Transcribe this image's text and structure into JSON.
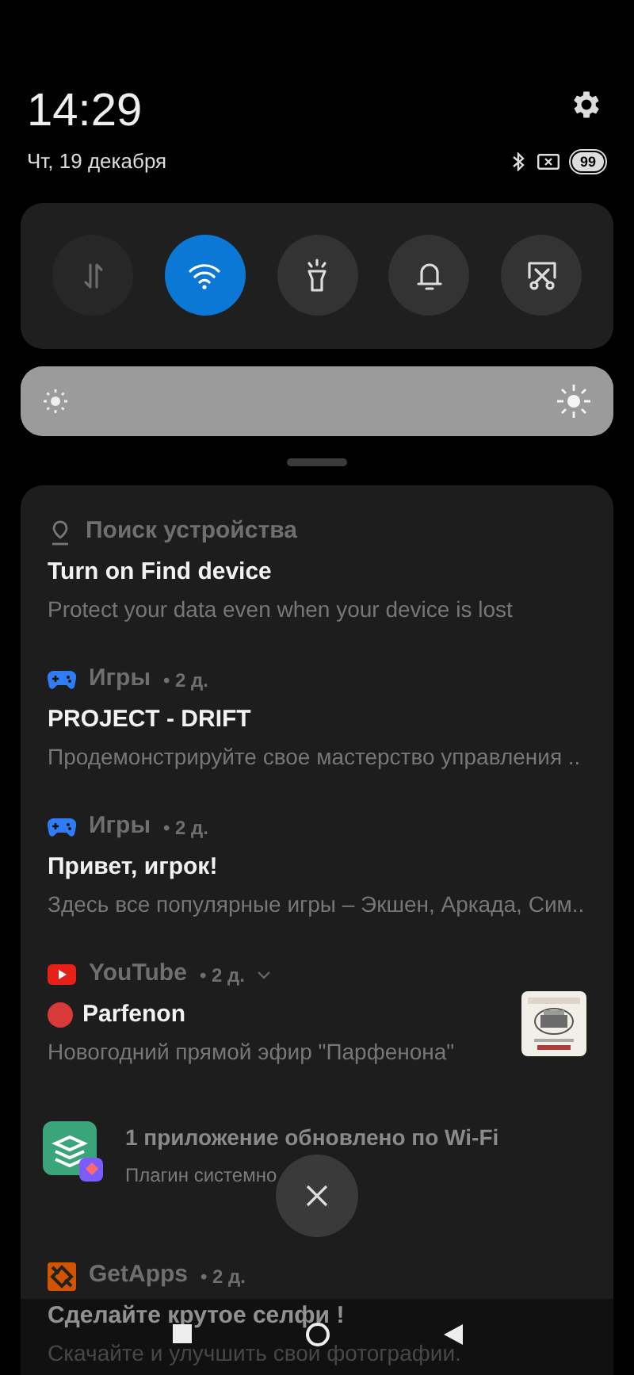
{
  "status": {
    "time": "14:29",
    "date": "Чт, 19 декабря",
    "battery": "99"
  },
  "toggles": [
    {
      "kind": "data",
      "on": false,
      "disabled": true
    },
    {
      "kind": "wifi",
      "on": true,
      "disabled": false
    },
    {
      "kind": "flashlight",
      "on": false,
      "disabled": false
    },
    {
      "kind": "bell",
      "on": false,
      "disabled": false
    },
    {
      "kind": "screenshot",
      "on": false,
      "disabled": false
    }
  ],
  "brightness": {
    "level": 1
  },
  "notifications": [
    {
      "kind": "device",
      "app": "Поиск устройства",
      "title": "Turn on Find device",
      "body": "Protect your data even when your device is lost"
    },
    {
      "kind": "games",
      "app": "Игры",
      "time": "• 2 д.",
      "title": "PROJECT - DRIFT",
      "body": "Продемонстрируйте свое мастерство управления .."
    },
    {
      "kind": "games",
      "app": "Игры",
      "time": "• 2 д.",
      "title": "Привет, игрок!",
      "body": "Здесь все популярные игры – Экшен, Аркада, Сим.."
    },
    {
      "kind": "youtube",
      "app": "YouTube",
      "time": "• 2 д.",
      "title": "Parfenon",
      "body": "Новогодний прямой эфир \"Парфенона\""
    },
    {
      "kind": "update",
      "title": "1 приложение обновлено по Wi-Fi",
      "body": "Плагин системно"
    },
    {
      "kind": "getapps",
      "app": "GetApps",
      "time": "• 2 д.",
      "title": "Сделайте крутое селфи !",
      "body": "Скачайте и улучшить свои фотографии."
    }
  ]
}
